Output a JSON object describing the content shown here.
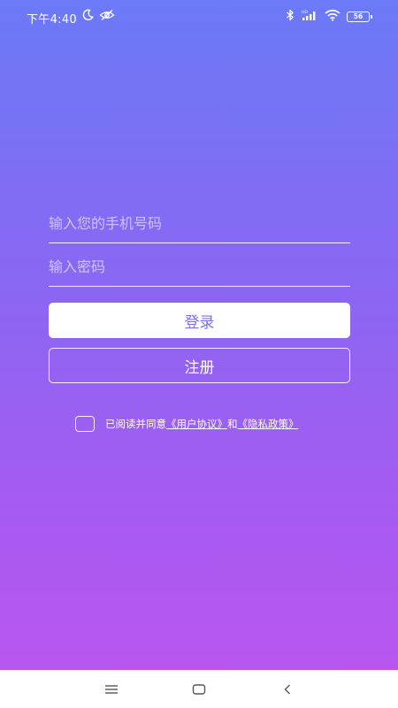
{
  "status_bar": {
    "time": "下午4:40",
    "battery": "56",
    "icons": [
      "moon-icon",
      "eye-off-icon",
      "bluetooth-icon",
      "signal-icon",
      "wifi-icon",
      "battery-icon"
    ]
  },
  "login": {
    "phone_placeholder": "输入您的手机号码",
    "phone_value": "",
    "password_placeholder": "输入密码",
    "password_value": "",
    "login_label": "登录",
    "register_label": "注册"
  },
  "agreement": {
    "prefix": "已阅读并同意",
    "user_agreement": "《用户协议》",
    "conjunction": "和",
    "privacy_policy": "《隐私政策》",
    "checked": false
  },
  "nav_bar": {
    "icons": [
      "menu-icon",
      "home-icon",
      "back-icon"
    ]
  },
  "colors": {
    "gradient_top": "#6b7af6",
    "gradient_bottom": "#bd54ef",
    "login_text": "#7b6ff0"
  }
}
